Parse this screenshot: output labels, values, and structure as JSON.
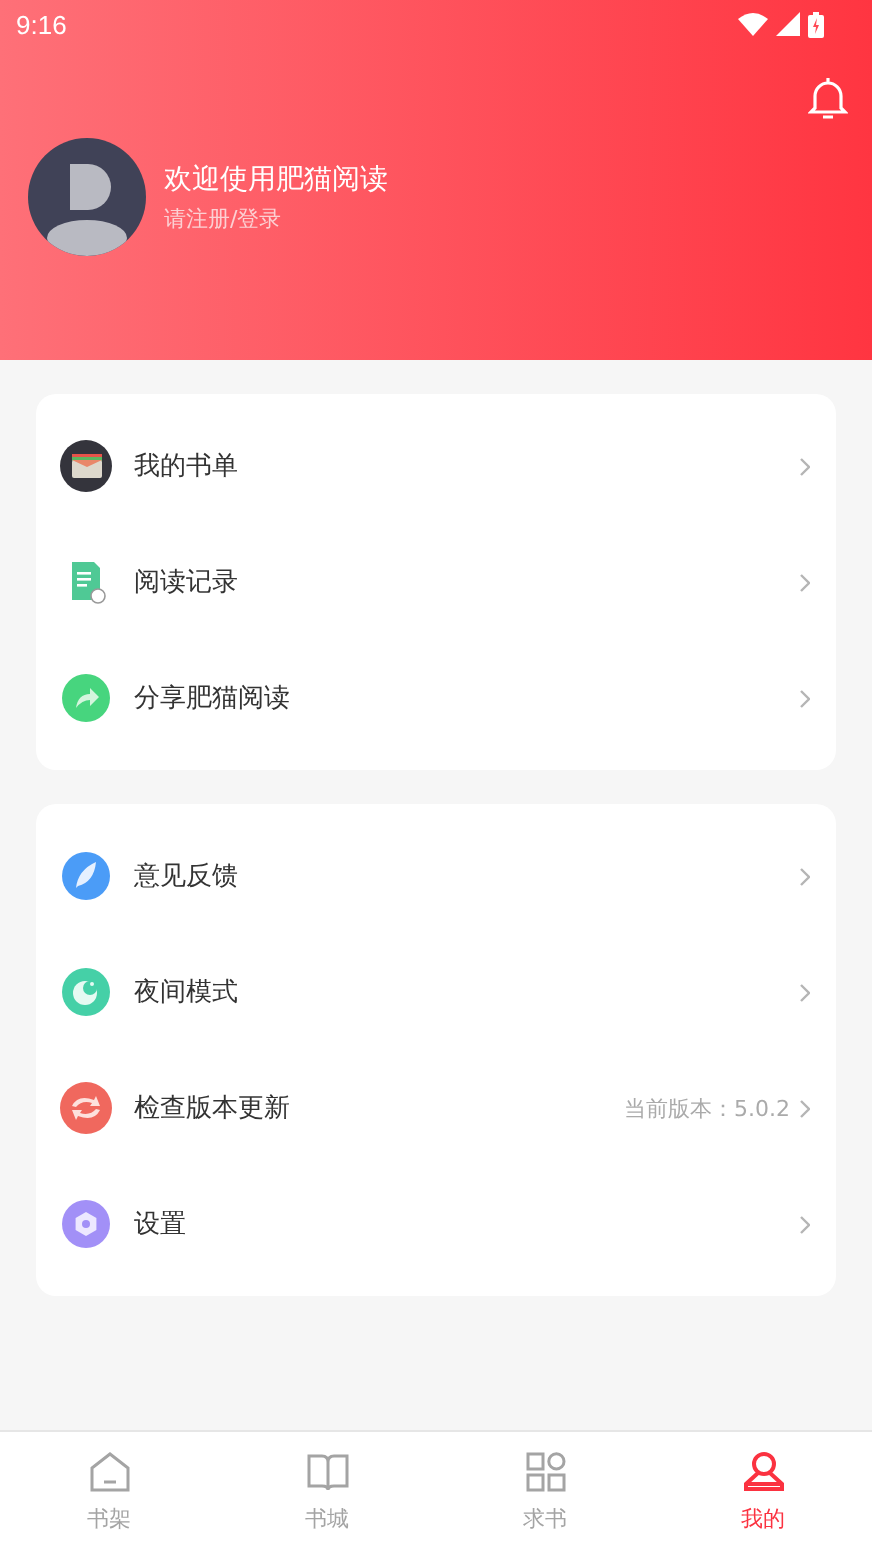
{
  "status_bar": {
    "time": "9:16"
  },
  "profile": {
    "greeting": "欢迎使用肥猫阅读",
    "login": "请注册/登录"
  },
  "menu_groups": [
    {
      "items": [
        {
          "kind": "booklist",
          "label": "我的书单"
        },
        {
          "kind": "history",
          "label": "阅读记录"
        },
        {
          "kind": "share",
          "label": "分享肥猫阅读"
        }
      ]
    },
    {
      "items": [
        {
          "kind": "feedback",
          "label": "意见反馈"
        },
        {
          "kind": "night",
          "label": "夜间模式"
        },
        {
          "kind": "update",
          "label": "检查版本更新",
          "detail": "当前版本：5.0.2"
        },
        {
          "kind": "settings",
          "label": "设置"
        }
      ]
    }
  ],
  "tabs": [
    {
      "kind": "shelf",
      "label": "书架",
      "selected": false
    },
    {
      "kind": "store",
      "label": "书城",
      "selected": false
    },
    {
      "kind": "request",
      "label": "求书",
      "selected": false
    },
    {
      "kind": "mine",
      "label": "我的",
      "selected": true
    }
  ]
}
